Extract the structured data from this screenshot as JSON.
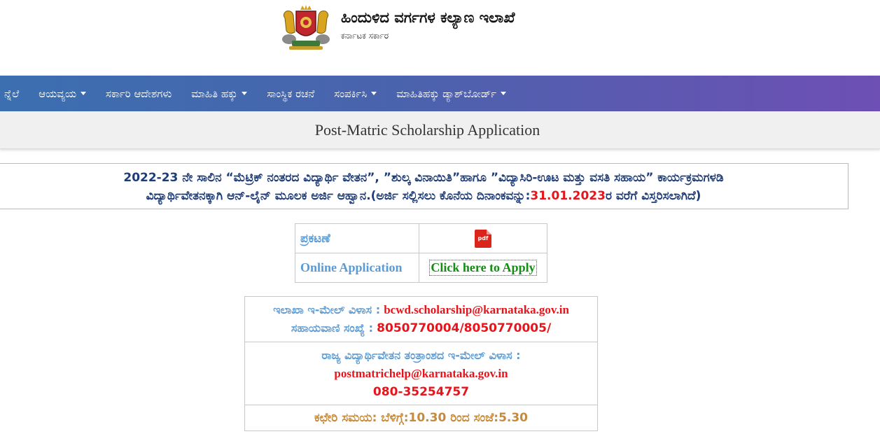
{
  "header": {
    "title": "ಹಿಂದುಳಿದ ವರ್ಗಗಳ ಕಲ್ಯಾಣ ಇಲಾಖೆ",
    "subtitle": "ಕರ್ನಾಟಕ ಸರ್ಕಾರ",
    "emblem_icon": "karnataka-emblem-icon"
  },
  "nav": {
    "items": [
      {
        "label": "ನ್ನೆಲೆ",
        "dropdown": false
      },
      {
        "label": "ಆಯವ್ಯಯ",
        "dropdown": true
      },
      {
        "label": "ಸರ್ಕಾರಿ ಆದೇಶಗಳು",
        "dropdown": false
      },
      {
        "label": "ಮಾಹಿತಿ ಹಕ್ಕು",
        "dropdown": true
      },
      {
        "label": "ಸಾಂಸ್ಥಿಕ ರಚನೆ",
        "dropdown": false
      },
      {
        "label": "ಸಂಪರ್ಕಿಸಿ",
        "dropdown": true
      },
      {
        "label": "ಮಾಹಿತಿಹಕ್ಕು ಡ್ಯಾಶ್‌ಬೋರ್ಡ್",
        "dropdown": true
      }
    ]
  },
  "page": {
    "title": "Post-Matric Scholarship Application"
  },
  "notice": {
    "line1": "2022-23 ನೇ ಸಾಲಿನ “ಮೆಟ್ರಿಕ್ ನಂತರದ ವಿದ್ಯಾರ್ಥಿ ವೇತನ”, ”ಶುಲ್ಕ ವಿನಾಯಿತಿ”ಹಾಗೂ ”ವಿದ್ಯಾಸಿರಿ-ಊಟ ಮತ್ತು ವಸತಿ ಸಹಾಯ” ಕಾರ್ಯಕ್ರಮಗಳಡಿ",
    "line2_before": "ವಿದ್ಯಾರ್ಥಿವೇತನಕ್ಕಾಗಿ ಆನ್-ಲೈನ್ ಮೂಲಕ ಅರ್ಜಿ ಆಹ್ವಾನ.(ಅರ್ಜಿ ಸಲ್ಲಿಸಲು ಕೊನೆಯ ದಿನಾಂಕವನ್ನು:",
    "deadline": "31.01.2023",
    "line2_after": "ರ ವರೆಗೆ ವಿಸ್ತರಿಸಲಾಗಿದೆ)"
  },
  "application_table": {
    "announcement_label": "ಪ್ರಕಟಣೆ",
    "pdf_icon_text": "pdf",
    "online_label": "Online Application",
    "apply_link": "Click here to Apply"
  },
  "contact": {
    "dept_email_label": "ಇಲಾಖಾ ಇ-ಮೇಲ್ ವಿಳಾಸ :",
    "dept_email": "bcwd.scholarship@karnataka.gov.in",
    "helpline_label": "ಸಹಾಯವಾಣಿ ಸಂಖ್ಯೆ :",
    "helpline": "8050770004/8050770005/",
    "state_email_label": "ರಾಜ್ಯ ವಿದ್ಯಾರ್ಥಿವೇತನ ತಂತ್ರಾಂಶದ ಇ-ಮೇಲ್ ವಿಳಾಸ :",
    "state_email": "postmatrichelp@karnataka.gov.in",
    "state_phone": "080-35254757",
    "office_hours": "ಕಛೇರಿ ಸಮಯ: ಬೆಳಿಗ್ಗೆ:10.30 ರಿಂದ ಸಂಜೆ:5.30"
  },
  "colors": {
    "nav_start": "#3b6fb0",
    "nav_end": "#6e4fb4",
    "notice_text": "#1d3c78",
    "highlight_red": "#e8141b",
    "label_blue": "#5b9bd5",
    "link_green": "#138d13",
    "hours_gold": "#c58a3c"
  }
}
